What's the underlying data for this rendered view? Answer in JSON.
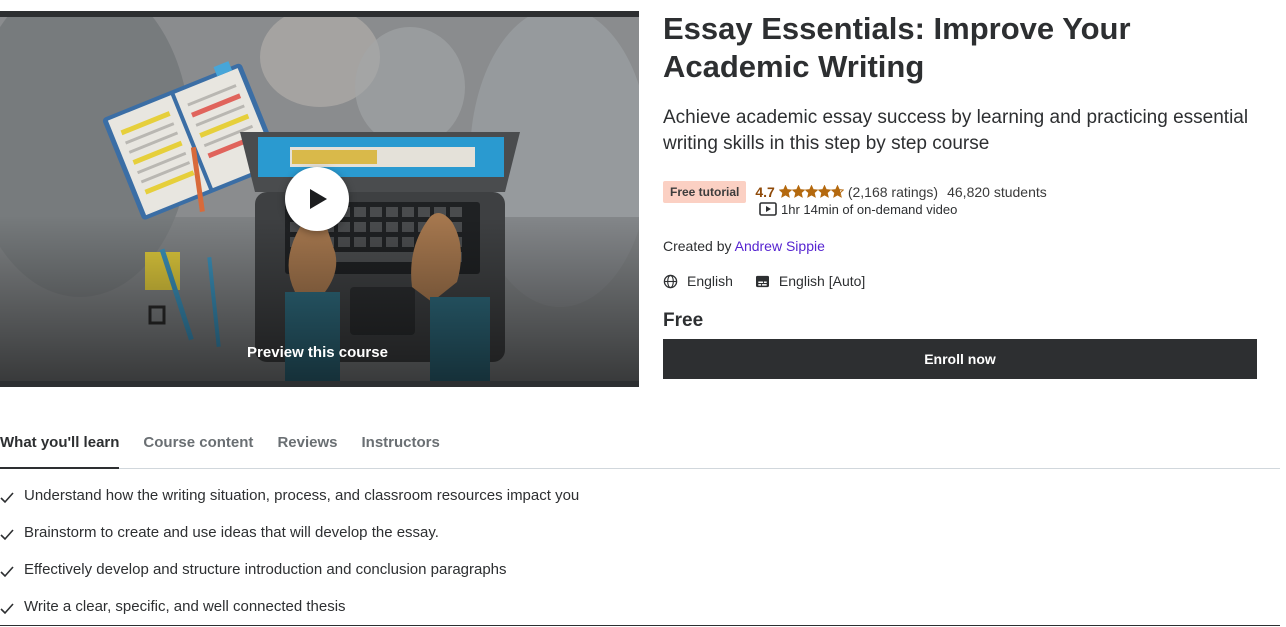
{
  "preview": {
    "label": "Preview this course",
    "play_icon": "play-icon"
  },
  "course": {
    "title": "Essay Essentials: Improve Your Academic Writing",
    "subtitle": "Achieve academic essay success by learning and practicing essential writing skills in this step by step course",
    "badge": "Free tutorial",
    "rating": "4.7",
    "rating_value": 4.7,
    "ratings_count": "(2,168 ratings)",
    "students": "46,820 students",
    "video_length": "1hr 14min of on-demand video",
    "created_by_label": "Created by",
    "instructor": "Andrew Sippie",
    "language": "English",
    "captions": "English [Auto]",
    "price": "Free",
    "enroll_label": "Enroll now"
  },
  "tabs": [
    {
      "label": "What you'll learn",
      "active": true
    },
    {
      "label": "Course content",
      "active": false
    },
    {
      "label": "Reviews",
      "active": false
    },
    {
      "label": "Instructors",
      "active": false
    }
  ],
  "learn": [
    "Understand how the writing situation, process, and classroom resources impact you",
    "Brainstorm to create and use ideas that will develop the essay.",
    "Effectively develop and structure introduction and conclusion paragraphs",
    "Write a clear, specific, and well connected thesis"
  ],
  "colors": {
    "dark": "#2d2f31",
    "badge_bg": "#fbd0c3",
    "rating": "#8f4a09",
    "star": "#b4690e",
    "link": "#5624d0"
  }
}
